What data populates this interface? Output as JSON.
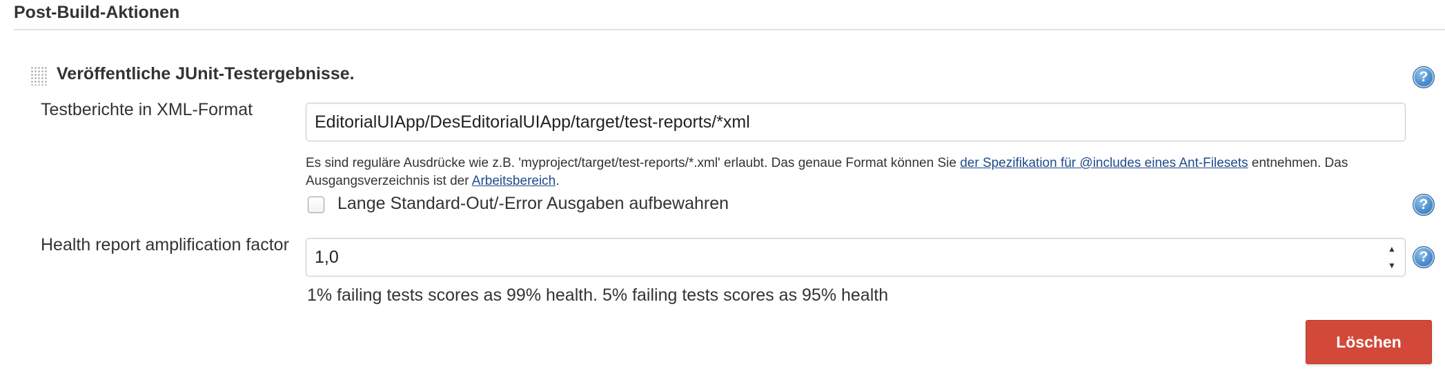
{
  "section": {
    "title": "Post-Build-Aktionen"
  },
  "junit": {
    "title": "Veröffentliche JUnit-Testergebnisse.",
    "help_symbol": "?",
    "reports_label": "Testberichte in XML-Format",
    "reports_value": "EditorialUIApp/DesEditorialUIApp/target/test-reports/*xml",
    "description": {
      "part1": "Es sind reguläre Ausdrücke wie z.B. 'myproject/target/test-reports/*.xml' erlaubt. Das genaue Format können Sie ",
      "link1": "der Spezifikation für @includes eines Ant-Filesets",
      "part2": " entnehmen. Das Ausgangsverzeichnis ist der ",
      "link2": "Arbeitsbereich",
      "part3": "."
    },
    "keep_output_label": "Lange Standard-Out/-Error Ausgaben aufbewahren",
    "health_label": "Health report amplification factor",
    "health_value": "1,0",
    "health_hint": "1% failing tests scores as 99% health. 5% failing tests scores as 95% health",
    "delete_label": "Löschen"
  },
  "icons": {
    "help": "help-icon",
    "drag": "drag-handle-icon",
    "spinner_up": "chevron-up-icon",
    "spinner_down": "chevron-down-icon"
  },
  "colors": {
    "delete_button": "#d24939",
    "link": "#1f4a8c",
    "help_icon": "#4a8ccc"
  }
}
